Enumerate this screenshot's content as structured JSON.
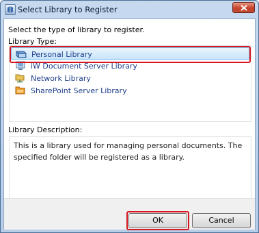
{
  "window": {
    "title": "Select Library to Register"
  },
  "prompt": "Select the type of library to register.",
  "library_type": {
    "label": "Library Type:",
    "items": [
      {
        "label": "Personal Library",
        "icon": "personal-library-icon",
        "selected": true
      },
      {
        "label": "iW Document Server Library",
        "icon": "document-server-icon",
        "selected": false
      },
      {
        "label": "Network Library",
        "icon": "network-library-icon",
        "selected": false
      },
      {
        "label": "SharePoint Server Library",
        "icon": "sharepoint-library-icon",
        "selected": false
      }
    ]
  },
  "library_description": {
    "label": "Library Description:",
    "text": "This is a library used for managing personal documents. The specified folder will be registered as a library."
  },
  "buttons": {
    "ok": "OK",
    "cancel": "Cancel"
  },
  "colors": {
    "highlight": "#d6171f",
    "selection": "#c9e5f9"
  }
}
